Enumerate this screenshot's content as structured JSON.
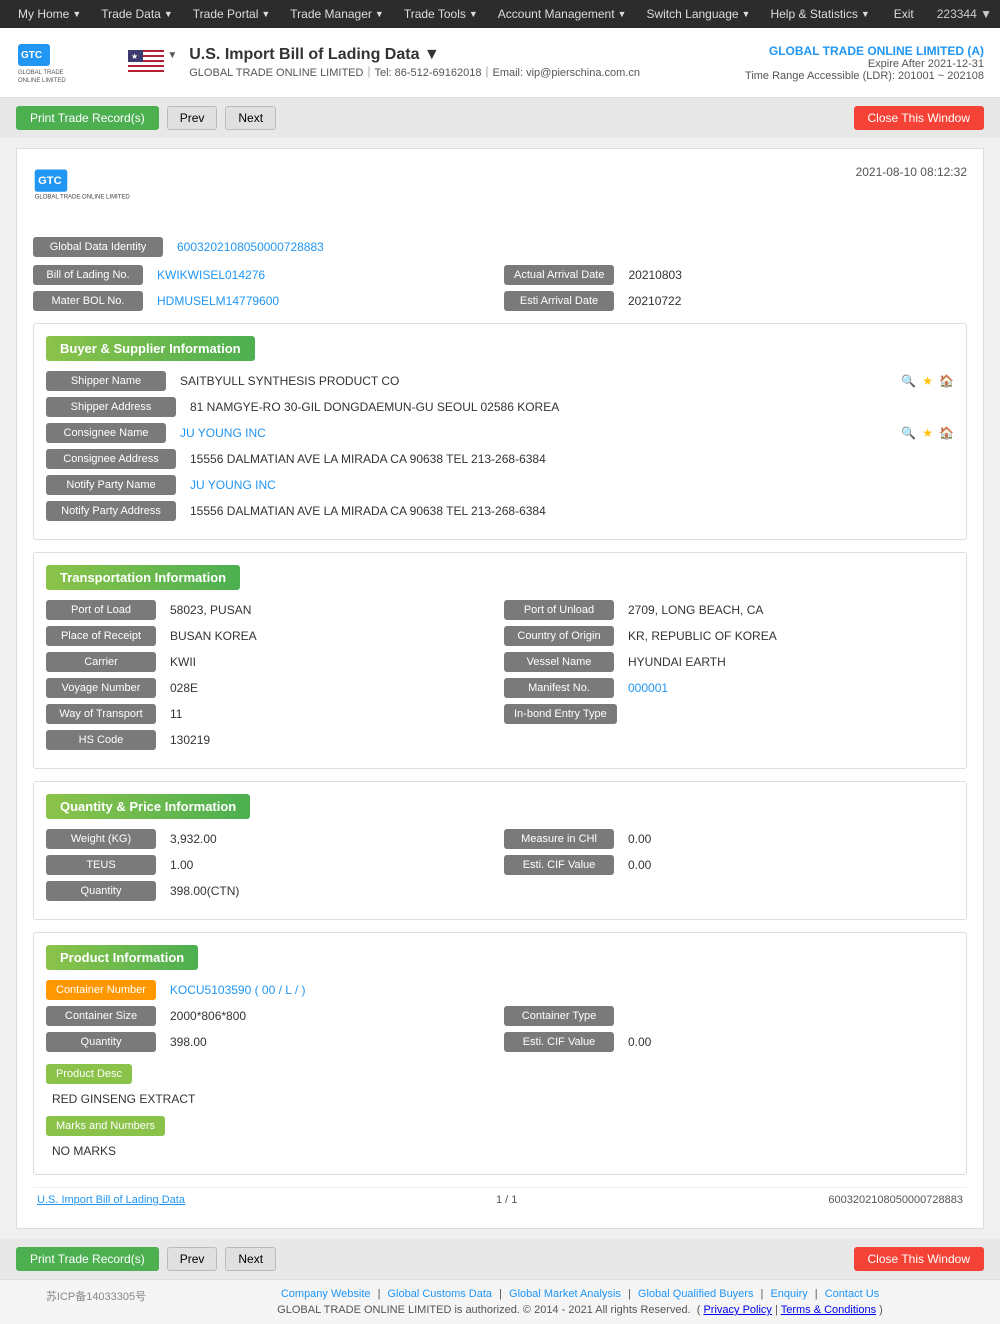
{
  "topnav": {
    "items": [
      {
        "label": "My Home",
        "arrow": true
      },
      {
        "label": "Trade Data",
        "arrow": true
      },
      {
        "label": "Trade Portal",
        "arrow": true
      },
      {
        "label": "Trade Manager",
        "arrow": true
      },
      {
        "label": "Trade Tools",
        "arrow": true
      },
      {
        "label": "Account Management",
        "arrow": true
      },
      {
        "label": "Switch Language",
        "arrow": true
      },
      {
        "label": "Help & Statistics",
        "arrow": true
      },
      {
        "label": "Exit",
        "arrow": false
      }
    ],
    "user_id": "223344 ▼"
  },
  "header": {
    "title": "U.S. Import Bill of Lading Data ▼",
    "subtitle": "GLOBAL TRADE ONLINE LIMITED｜Tel: 86-512-69162018｜Email: vip@pierschina.com.cn",
    "company": "GLOBAL TRADE ONLINE LIMITED (A)",
    "expire": "Expire After 2021-12-31",
    "time_range": "Time Range Accessible (LDR): 201001 ~ 202108"
  },
  "actions": {
    "print_label": "Print Trade Record(s)",
    "prev_label": "Prev",
    "next_label": "Next",
    "close_label": "Close This Window"
  },
  "document": {
    "date": "2021-08-10 08:12:32",
    "global_data_identity_label": "Global Data Identity",
    "global_data_identity_value": "6003202108050000728883",
    "bill_of_lading_label": "Bill of Lading No.",
    "bill_of_lading_value": "KWIKWISEL014276",
    "actual_arrival_label": "Actual Arrival Date",
    "actual_arrival_value": "20210803",
    "master_bol_label": "Mater BOL No.",
    "master_bol_value": "HDMUSELM14779600",
    "esti_arrival_label": "Esti Arrival Date",
    "esti_arrival_value": "20210722"
  },
  "buyer_supplier": {
    "section_title": "Buyer & Supplier Information",
    "shipper_name_label": "Shipper Name",
    "shipper_name_value": "SAITBYULL SYNTHESIS PRODUCT CO",
    "shipper_address_label": "Shipper Address",
    "shipper_address_value": "81 NAMGYE-RO 30-GIL DONGDAEMUN-GU SEOUL 02586 KOREA",
    "consignee_name_label": "Consignee Name",
    "consignee_name_value": "JU YOUNG INC",
    "consignee_address_label": "Consignee Address",
    "consignee_address_value": "15556 DALMATIAN AVE LA MIRADA CA 90638 TEL 213-268-6384",
    "notify_party_name_label": "Notify Party Name",
    "notify_party_name_value": "JU YOUNG INC",
    "notify_party_address_label": "Notify Party Address",
    "notify_party_address_value": "15556 DALMATIAN AVE LA MIRADA CA 90638 TEL 213-268-6384"
  },
  "transportation": {
    "section_title": "Transportation Information",
    "port_of_load_label": "Port of Load",
    "port_of_load_value": "58023, PUSAN",
    "port_of_unload_label": "Port of Unload",
    "port_of_unload_value": "2709, LONG BEACH, CA",
    "place_of_receipt_label": "Place of Receipt",
    "place_of_receipt_value": "BUSAN KOREA",
    "country_of_origin_label": "Country of Origin",
    "country_of_origin_value": "KR, REPUBLIC OF KOREA",
    "carrier_label": "Carrier",
    "carrier_value": "KWII",
    "vessel_name_label": "Vessel Name",
    "vessel_name_value": "HYUNDAI EARTH",
    "voyage_number_label": "Voyage Number",
    "voyage_number_value": "028E",
    "manifest_no_label": "Manifest No.",
    "manifest_no_value": "000001",
    "way_of_transport_label": "Way of Transport",
    "way_of_transport_value": "11",
    "inbond_entry_label": "In-bond Entry Type",
    "inbond_entry_value": "",
    "hs_code_label": "HS Code",
    "hs_code_value": "130219"
  },
  "quantity_price": {
    "section_title": "Quantity & Price Information",
    "weight_kg_label": "Weight (KG)",
    "weight_kg_value": "3,932.00",
    "measure_in_chl_label": "Measure in CHl",
    "measure_in_chl_value": "0.00",
    "teus_label": "TEUS",
    "teus_value": "1.00",
    "esti_cif_label": "Esti. CIF Value",
    "esti_cif_value": "0.00",
    "quantity_label": "Quantity",
    "quantity_value": "398.00(CTN)"
  },
  "product": {
    "section_title": "Product Information",
    "container_number_label": "Container Number",
    "container_number_value": "KOCU5103590 ( 00 / L / )",
    "container_size_label": "Container Size",
    "container_size_value": "2000*806*800",
    "container_type_label": "Container Type",
    "container_type_value": "",
    "quantity_label": "Quantity",
    "quantity_value": "398.00",
    "esti_cif_label": "Esti. CIF Value",
    "esti_cif_value": "0.00",
    "product_desc_label": "Product Desc",
    "product_desc_value": "RED GINSENG EXTRACT",
    "marks_label": "Marks and Numbers",
    "marks_value": "NO MARKS"
  },
  "doc_footer": {
    "left_label": "U.S. Import Bill of Lading Data",
    "center": "1 / 1",
    "right": "6003202108050000728883"
  },
  "page_footer": {
    "icp": "苏ICP备14033305号",
    "links": [
      "Company Website",
      "Global Customs Data",
      "Global Market Analysis",
      "Global Qualified Buyers",
      "Enquiry",
      "Contact Us"
    ],
    "copyright": "GLOBAL TRADE ONLINE LIMITED is authorized. © 2014 - 2021 All rights Reserved.",
    "privacy": "Privacy Policy",
    "terms": "Terms & Conditions"
  }
}
